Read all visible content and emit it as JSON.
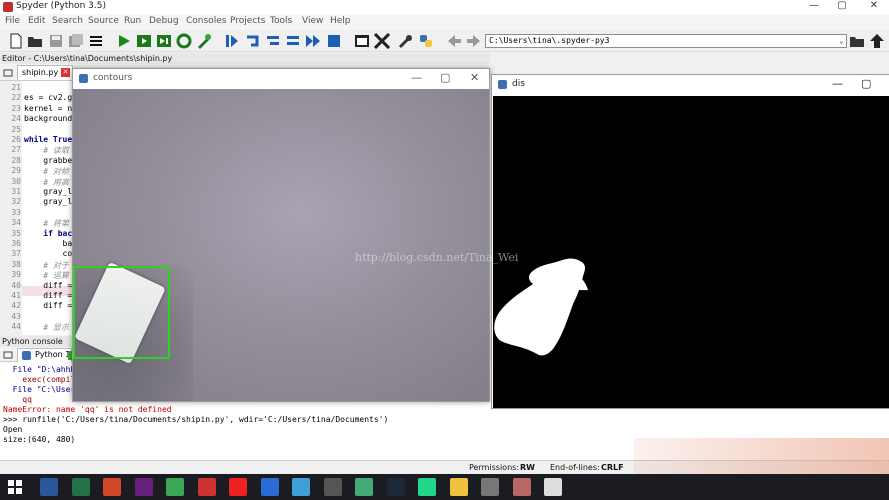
{
  "app": {
    "title": "Spyder (Python 3.5)",
    "controls": {
      "minimize": "—",
      "maximize": "▢",
      "close": "✕"
    }
  },
  "menu": [
    "File",
    "Edit",
    "Search",
    "Source",
    "Run",
    "Debug",
    "Consoles",
    "Projects",
    "Tools",
    "View",
    "Help"
  ],
  "toolbar": {
    "path": "C:\\Users\\tina\\.spyder-py3",
    "icons": [
      "new-file-icon",
      "open-file-icon",
      "save-icon",
      "save-all-icon",
      "list-icon",
      "run-icon",
      "run-cell-icon",
      "run-cell-advance-icon",
      "rerun-icon",
      "debug-icon",
      "step-icon",
      "step-into-icon",
      "step-return-icon",
      "continue-icon",
      "stop-icon",
      "maximize-pane-icon",
      "fullscreen-icon",
      "wrench-icon",
      "python-path-icon",
      "back-icon",
      "forward-icon",
      "browse-folder-icon",
      "up-dir-icon"
    ]
  },
  "editor": {
    "label": "Editor - C:\\Users\\tina\\Documents\\shipin.py",
    "tab": "shipin.py",
    "lines": [
      {
        "n": "21",
        "text": ""
      },
      {
        "n": "22",
        "text": "es = cv2.ge"
      },
      {
        "n": "23",
        "text": "kernel = np"
      },
      {
        "n": "24",
        "text": "background "
      },
      {
        "n": "25",
        "text": ""
      },
      {
        "n": "26",
        "text": "while True"
      },
      {
        "n": "27",
        "text": "    # 读取"
      },
      {
        "n": "28",
        "text": "    grabbed"
      },
      {
        "n": "29",
        "text": "    # 对帧"
      },
      {
        "n": "30",
        "text": "    # 用高"
      },
      {
        "n": "31",
        "text": "    gray_lw"
      },
      {
        "n": "32",
        "text": "    gray_lw"
      },
      {
        "n": "33",
        "text": ""
      },
      {
        "n": "34",
        "text": "    # 将第"
      },
      {
        "n": "35",
        "text": "    if back"
      },
      {
        "n": "36",
        "text": "        bac"
      },
      {
        "n": "37",
        "text": "        con"
      },
      {
        "n": "38",
        "text": "    # 对于"
      },
      {
        "n": "39",
        "text": "    # 运算"
      },
      {
        "n": "40",
        "text": "    diff ="
      },
      {
        "n": "41",
        "text": "    diff ="
      },
      {
        "n": "42",
        "text": "    diff ="
      },
      {
        "n": "43",
        "text": ""
      },
      {
        "n": "44",
        "text": "    # 显示"
      }
    ]
  },
  "console": {
    "label": "Python console",
    "tab": "Python 1",
    "lines": [
      {
        "text": "  File \"D:\\ahhhh",
        "color": "#00008b"
      },
      {
        "text": "    exec(compile",
        "color": "#8b0000"
      },
      {
        "text": "  File \"C:\\User",
        "color": "#00008b"
      },
      {
        "text": "    qq",
        "color": "#8b0000"
      },
      {
        "text": "NameError: name 'qq' is not defined",
        "color": "#c00000"
      },
      {
        "text": ">>> runfile('C:/Users/tina/Documents/shipin.py', wdir='C:/Users/tina/Documents')",
        "color": "#000"
      },
      {
        "text": "Open",
        "color": "#000"
      },
      {
        "text": "size:(640, 480)",
        "color": "#000"
      }
    ]
  },
  "status": {
    "permissions_label": "Permissions:",
    "permissions_value": "RW",
    "eol_label": "End-of-lines:",
    "eol_value": "CRLF"
  },
  "windows": {
    "contours": {
      "title": "contours"
    },
    "dis": {
      "title": "dis"
    }
  },
  "watermark": "http://blog.csdn.net/Tina_Wei",
  "taskbar": {
    "apps": [
      {
        "name": "word-icon",
        "color": "#2b579a"
      },
      {
        "name": "excel-icon",
        "color": "#217346"
      },
      {
        "name": "powerpoint-icon",
        "color": "#d24726"
      },
      {
        "name": "visual-studio-icon",
        "color": "#68217a"
      },
      {
        "name": "browser-icon",
        "color": "#3aa757"
      },
      {
        "name": "robot-icon",
        "color": "#c33"
      },
      {
        "name": "netease-icon",
        "color": "#e22"
      },
      {
        "name": "bird-icon",
        "color": "#2a6bd6"
      },
      {
        "name": "note-icon",
        "color": "#3fa0d8"
      },
      {
        "name": "network-icon",
        "color": "#555"
      },
      {
        "name": "ship-icon",
        "color": "#4a7"
      },
      {
        "name": "steam-icon",
        "color": "#1b2838"
      },
      {
        "name": "pycharm-icon",
        "color": "#21d789"
      },
      {
        "name": "folder-icon",
        "color": "#f0c040"
      },
      {
        "name": "settings-icon",
        "color": "#777"
      },
      {
        "name": "image-icon",
        "color": "#b66"
      },
      {
        "name": "pv-icon",
        "color": "#ddd"
      }
    ]
  }
}
